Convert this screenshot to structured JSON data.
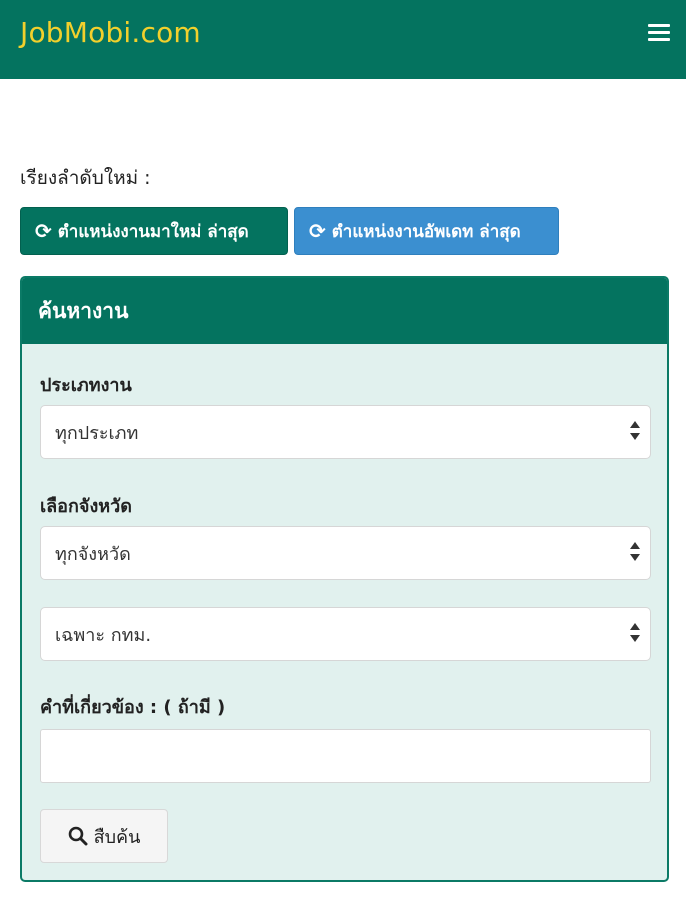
{
  "header": {
    "brand": "JobMobi.com",
    "menu_icon": "hamburger-menu-icon"
  },
  "sort": {
    "label": "เรียงลำดับใหม่ :",
    "new_label": "ตำแหน่งงานมาใหม่ ล่าสุด",
    "updated_label": "ตำแหน่งงานอัพเดท ล่าสุด",
    "icon": "refresh-icon"
  },
  "search_panel": {
    "title": "ค้นหางาน",
    "job_type_label": "ประเภทงาน",
    "job_type_value": "ทุกประเภท",
    "province_label": "เลือกจังหวัด",
    "province_value": "ทุกจังหวัด",
    "area_value": "เฉพาะ กทม.",
    "keyword_label": "คำที่เกี่ยวข้อง : ( ถ้ามี )",
    "keyword_value": "",
    "search_label": "สืบค้น",
    "search_icon": "magnifier-icon"
  },
  "colors": {
    "primary": "#04735f",
    "info": "#3b8fd0",
    "brand_text": "#f2d02c",
    "panel_bg": "#e1f1ee"
  }
}
